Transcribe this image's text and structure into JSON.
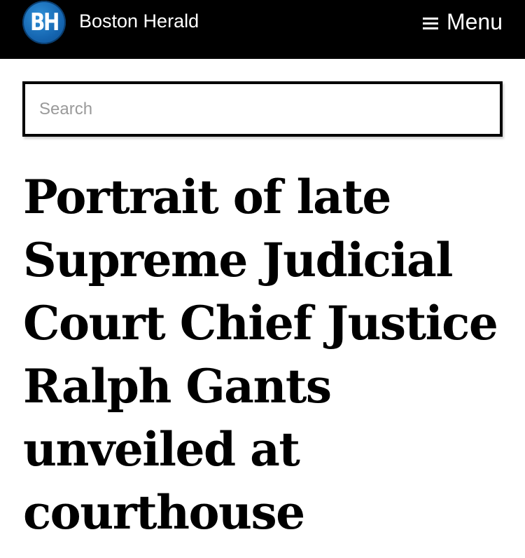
{
  "header": {
    "logo_text": "BH",
    "site_name": "Boston Herald",
    "menu_label": "Menu",
    "menu_icon": "hamburger-icon",
    "logo_color": "#1565b0"
  },
  "search": {
    "placeholder": "Search",
    "value": ""
  },
  "article": {
    "headline": "Portrait of late Supreme Judicial Court Chief Justice Ralph Gants unveiled at courthouse"
  }
}
